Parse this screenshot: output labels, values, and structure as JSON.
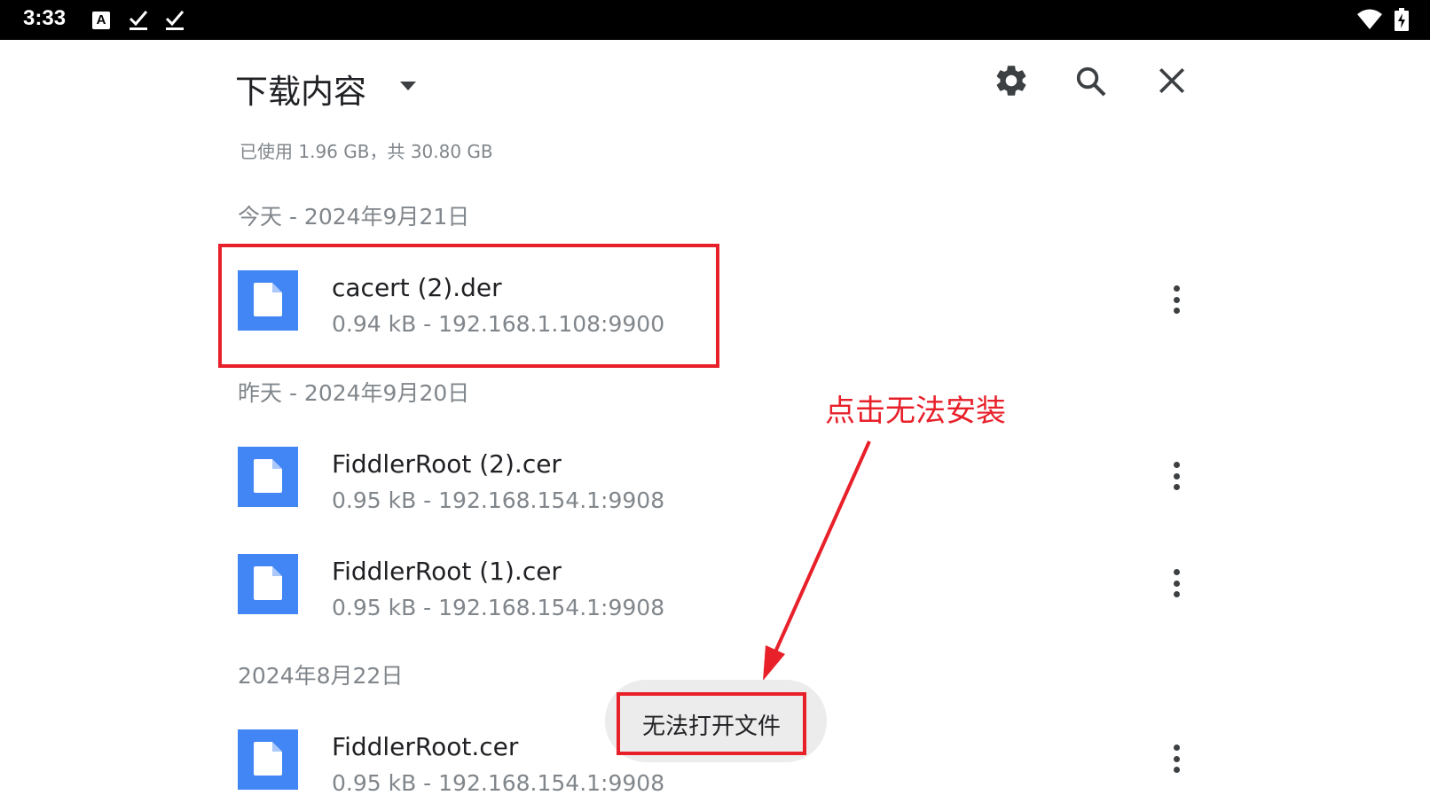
{
  "status_bar": {
    "time": "3:33",
    "a_icon_label": "A",
    "icons": [
      "a-notification-icon",
      "download-done-icon",
      "download-done-icon",
      "wifi-icon",
      "battery-charging-icon"
    ]
  },
  "header": {
    "title": "下载内容",
    "icons": [
      "dropdown-arrow-icon",
      "gear-icon",
      "search-icon",
      "close-icon"
    ]
  },
  "storage": "已使用 1.96 GB，共 30.80 GB",
  "sections": [
    {
      "header": "今天 - 2024年9月21日",
      "files": [
        {
          "name": "cacert (2).der",
          "meta": "0.94 kB - 192.168.1.108:9900"
        }
      ]
    },
    {
      "header": "昨天 - 2024年9月20日",
      "files": [
        {
          "name": "FiddlerRoot (2).cer",
          "meta": "0.95 kB - 192.168.154.1:9908"
        },
        {
          "name": "FiddlerRoot (1).cer",
          "meta": "0.95 kB - 192.168.154.1:9908"
        }
      ]
    },
    {
      "header": "2024年8月22日",
      "files": [
        {
          "name": "FiddlerRoot.cer",
          "meta": "0.95 kB - 192.168.154.1:9908"
        }
      ]
    }
  ],
  "toast": "无法打开文件",
  "annotation": {
    "text": "点击无法安装",
    "color": "#e8202a"
  },
  "colors": {
    "file_icon": "#4285f4",
    "secondary_text": "#80868b",
    "annotation": "#e8202a"
  }
}
